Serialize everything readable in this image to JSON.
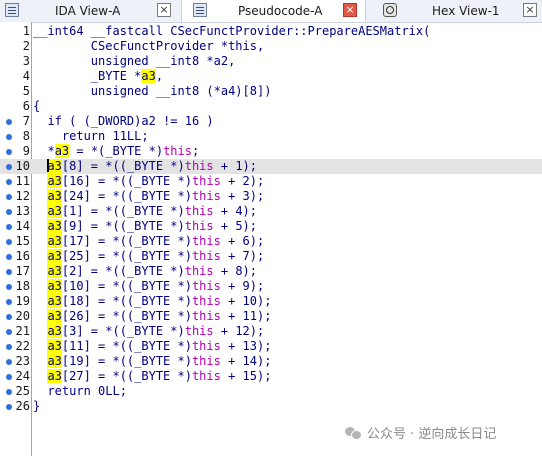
{
  "tabs": [
    {
      "label": "IDA View-A",
      "icon": "ida-view-icon",
      "close": "×",
      "active": false
    },
    {
      "label": "Pseudocode-A",
      "icon": "pseudocode-icon",
      "close": "×",
      "active": true
    },
    {
      "label": "Hex View-1",
      "icon": "hex-view-icon",
      "close": "×",
      "active": false
    }
  ],
  "code_lines": [
    {
      "n": "1",
      "bp": false,
      "segs": [
        [
          "__int64 __fastcall CSecFunctProvider::PrepareAESMatrix(",
          "kw"
        ]
      ]
    },
    {
      "n": "2",
      "bp": false,
      "segs": [
        [
          "        CSecFunctProvider *this,",
          "kw"
        ]
      ]
    },
    {
      "n": "3",
      "bp": false,
      "segs": [
        [
          "        unsigned __int8 *a2,",
          "kw"
        ]
      ]
    },
    {
      "n": "4",
      "bp": false,
      "segs": [
        [
          "        _BYTE *",
          "kw"
        ],
        [
          "a3",
          "hl"
        ],
        [
          ",",
          "kw"
        ]
      ]
    },
    {
      "n": "5",
      "bp": false,
      "segs": [
        [
          "        unsigned __int8 (*a4)[8])",
          "kw"
        ]
      ]
    },
    {
      "n": "6",
      "bp": false,
      "segs": [
        [
          "{",
          "kw"
        ]
      ]
    },
    {
      "n": "7",
      "bp": true,
      "segs": [
        [
          "  if ( (_DWORD)a2 != 16 )",
          "kw"
        ]
      ]
    },
    {
      "n": "8",
      "bp": true,
      "segs": [
        [
          "    return 11LL;",
          "kw"
        ]
      ]
    },
    {
      "n": "9",
      "bp": true,
      "segs": [
        [
          "  *",
          "kw"
        ],
        [
          "a3",
          "hl"
        ],
        [
          " = *(_BYTE *)",
          "kw"
        ],
        [
          "this",
          "th"
        ],
        [
          ";",
          "kw"
        ]
      ]
    },
    {
      "n": "10",
      "bp": true,
      "cur": true,
      "segs": [
        [
          "  ",
          "kw"
        ],
        [
          "a3",
          "hlcaret"
        ],
        [
          "[8] = *((_BYTE *)",
          "kw"
        ],
        [
          "this",
          "th"
        ],
        [
          " + 1);",
          "kw"
        ]
      ]
    },
    {
      "n": "11",
      "bp": true,
      "segs": [
        [
          "  ",
          "kw"
        ],
        [
          "a3",
          "hl"
        ],
        [
          "[16] = *((_BYTE *)",
          "kw"
        ],
        [
          "this",
          "th"
        ],
        [
          " + 2);",
          "kw"
        ]
      ]
    },
    {
      "n": "12",
      "bp": true,
      "segs": [
        [
          "  ",
          "kw"
        ],
        [
          "a3",
          "hl"
        ],
        [
          "[24] = *((_BYTE *)",
          "kw"
        ],
        [
          "this",
          "th"
        ],
        [
          " + 3);",
          "kw"
        ]
      ]
    },
    {
      "n": "13",
      "bp": true,
      "segs": [
        [
          "  ",
          "kw"
        ],
        [
          "a3",
          "hl"
        ],
        [
          "[1] = *((_BYTE *)",
          "kw"
        ],
        [
          "this",
          "th"
        ],
        [
          " + 4);",
          "kw"
        ]
      ]
    },
    {
      "n": "14",
      "bp": true,
      "segs": [
        [
          "  ",
          "kw"
        ],
        [
          "a3",
          "hl"
        ],
        [
          "[9] = *((_BYTE *)",
          "kw"
        ],
        [
          "this",
          "th"
        ],
        [
          " + 5);",
          "kw"
        ]
      ]
    },
    {
      "n": "15",
      "bp": true,
      "segs": [
        [
          "  ",
          "kw"
        ],
        [
          "a3",
          "hl"
        ],
        [
          "[17] = *((_BYTE *)",
          "kw"
        ],
        [
          "this",
          "th"
        ],
        [
          " + 6);",
          "kw"
        ]
      ]
    },
    {
      "n": "16",
      "bp": true,
      "segs": [
        [
          "  ",
          "kw"
        ],
        [
          "a3",
          "hl"
        ],
        [
          "[25] = *((_BYTE *)",
          "kw"
        ],
        [
          "this",
          "th"
        ],
        [
          " + 7);",
          "kw"
        ]
      ]
    },
    {
      "n": "17",
      "bp": true,
      "segs": [
        [
          "  ",
          "kw"
        ],
        [
          "a3",
          "hl"
        ],
        [
          "[2] = *((_BYTE *)",
          "kw"
        ],
        [
          "this",
          "th"
        ],
        [
          " + 8);",
          "kw"
        ]
      ]
    },
    {
      "n": "18",
      "bp": true,
      "segs": [
        [
          "  ",
          "kw"
        ],
        [
          "a3",
          "hl"
        ],
        [
          "[10] = *((_BYTE *)",
          "kw"
        ],
        [
          "this",
          "th"
        ],
        [
          " + 9);",
          "kw"
        ]
      ]
    },
    {
      "n": "19",
      "bp": true,
      "segs": [
        [
          "  ",
          "kw"
        ],
        [
          "a3",
          "hl"
        ],
        [
          "[18] = *((_BYTE *)",
          "kw"
        ],
        [
          "this",
          "th"
        ],
        [
          " + 10);",
          "kw"
        ]
      ]
    },
    {
      "n": "20",
      "bp": true,
      "segs": [
        [
          "  ",
          "kw"
        ],
        [
          "a3",
          "hl"
        ],
        [
          "[26] = *((_BYTE *)",
          "kw"
        ],
        [
          "this",
          "th"
        ],
        [
          " + 11);",
          "kw"
        ]
      ]
    },
    {
      "n": "21",
      "bp": true,
      "segs": [
        [
          "  ",
          "kw"
        ],
        [
          "a3",
          "hl"
        ],
        [
          "[3] = *((_BYTE *)",
          "kw"
        ],
        [
          "this",
          "th"
        ],
        [
          " + 12);",
          "kw"
        ]
      ]
    },
    {
      "n": "22",
      "bp": true,
      "segs": [
        [
          "  ",
          "kw"
        ],
        [
          "a3",
          "hl"
        ],
        [
          "[11] = *((_BYTE *)",
          "kw"
        ],
        [
          "this",
          "th"
        ],
        [
          " + 13);",
          "kw"
        ]
      ]
    },
    {
      "n": "23",
      "bp": true,
      "segs": [
        [
          "  ",
          "kw"
        ],
        [
          "a3",
          "hl"
        ],
        [
          "[19] = *((_BYTE *)",
          "kw"
        ],
        [
          "this",
          "th"
        ],
        [
          " + 14);",
          "kw"
        ]
      ]
    },
    {
      "n": "24",
      "bp": true,
      "segs": [
        [
          "  ",
          "kw"
        ],
        [
          "a3",
          "hl"
        ],
        [
          "[27] = *((_BYTE *)",
          "kw"
        ],
        [
          "this",
          "th"
        ],
        [
          " + 15);",
          "kw"
        ]
      ]
    },
    {
      "n": "25",
      "bp": true,
      "segs": [
        [
          "  return 0LL;",
          "kw"
        ]
      ]
    },
    {
      "n": "26",
      "bp": true,
      "segs": [
        [
          "}",
          "kw"
        ]
      ]
    }
  ],
  "watermark": {
    "icon": "wechat-icon",
    "text": "公众号 · 逆向成长日记"
  },
  "colors": {
    "keyword": "#000080",
    "this": "#b000b0",
    "highlight": "#ffff00",
    "breakpoint_dot": "#2f6fdc",
    "current_line": "#e3e3e3"
  }
}
